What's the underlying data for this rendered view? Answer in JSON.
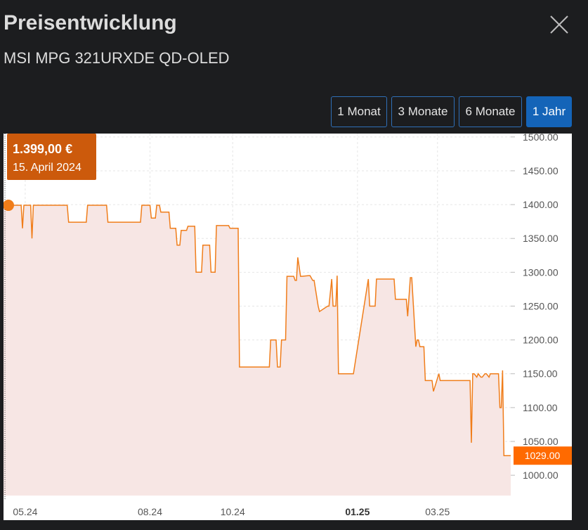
{
  "header": {
    "title": "Preisentwicklung",
    "subtitle": "MSI MPG 321URXDE QD-OLED",
    "close_icon": "close-icon"
  },
  "range_buttons": [
    {
      "label": "1 Monat",
      "active": false
    },
    {
      "label": "3 Monate",
      "active": false
    },
    {
      "label": "6 Monate",
      "active": false
    },
    {
      "label": "1 Jahr",
      "active": true
    }
  ],
  "tooltip": {
    "price": "1.399,00 €",
    "date": "15. April 2024"
  },
  "current_price_label": "1029.00",
  "colors": {
    "background": "#1c1d1f",
    "line": "#f07d1a",
    "area": "#f7e6e4",
    "tooltip_bg": "#cc5a0c",
    "current_label_bg": "#ff6a00",
    "active_button": "#1464b8"
  },
  "chart_data": {
    "type": "line",
    "x": [
      "2024-04-15",
      "2024-04-28",
      "2024-04-29",
      "2024-04-30",
      "2024-05-05",
      "2024-05-06",
      "2024-05-07",
      "2024-06-01",
      "2024-06-02",
      "2024-06-15",
      "2024-06-16",
      "2024-06-30",
      "2024-07-01",
      "2024-07-25",
      "2024-07-26",
      "2024-08-01",
      "2024-08-02",
      "2024-08-05",
      "2024-08-06",
      "2024-08-08",
      "2024-08-09",
      "2024-08-15",
      "2024-08-16",
      "2024-08-20",
      "2024-08-21",
      "2024-08-23",
      "2024-08-24",
      "2024-08-28",
      "2024-08-29",
      "2024-09-03",
      "2024-09-04",
      "2024-09-08",
      "2024-09-09",
      "2024-09-14",
      "2024-09-15",
      "2024-09-18",
      "2024-09-19",
      "2024-09-21",
      "2024-09-22",
      "2024-09-28",
      "2024-09-29",
      "2024-10-05",
      "2024-10-06",
      "2024-10-07",
      "2024-10-08",
      "2024-10-28",
      "2024-10-29",
      "2024-11-02",
      "2024-11-03",
      "2024-11-05",
      "2024-11-06",
      "2024-11-09",
      "2024-11-10",
      "2024-11-15",
      "2024-11-16",
      "2024-11-17",
      "2024-11-18",
      "2024-11-20",
      "2024-11-21",
      "2024-11-26",
      "2024-11-27",
      "2024-11-29",
      "2024-11-30",
      "2024-12-03",
      "2024-12-04",
      "2024-12-10",
      "2024-12-11",
      "2024-12-13",
      "2024-12-14",
      "2024-12-16",
      "2024-12-17",
      "2024-12-18",
      "2024-12-19",
      "2024-12-24",
      "2024-12-25",
      "2024-12-28",
      "2024-12-29",
      "2025-01-09",
      "2025-01-10",
      "2025-01-12",
      "2025-01-13",
      "2025-01-14",
      "2025-01-15",
      "2025-01-28",
      "2025-01-29",
      "2025-02-01",
      "2025-02-02",
      "2025-02-06",
      "2025-02-07",
      "2025-02-09",
      "2025-02-10",
      "2025-02-13",
      "2025-02-14",
      "2025-02-15",
      "2025-02-16",
      "2025-02-19",
      "2025-02-20",
      "2025-02-25",
      "2025-02-26",
      "2025-03-02",
      "2025-03-03",
      "2025-03-25",
      "2025-03-26",
      "2025-03-27",
      "2025-03-28",
      "2025-03-30",
      "2025-03-31",
      "2025-04-02",
      "2025-04-03",
      "2025-04-05",
      "2025-04-06",
      "2025-04-08",
      "2025-04-09",
      "2025-04-15",
      "2025-04-16",
      "2025-04-17",
      "2025-04-18",
      "2025-04-19",
      "2025-04-21",
      "2025-04-24"
    ],
    "values": [
      1399,
      1399,
      1365,
      1399,
      1399,
      1350,
      1399,
      1399,
      1374,
      1374,
      1399,
      1399,
      1374,
      1374,
      1399,
      1399,
      1380,
      1380,
      1399,
      1399,
      1389,
      1389,
      1365,
      1365,
      1340,
      1340,
      1362,
      1362,
      1368,
      1368,
      1300,
      1300,
      1340,
      1340,
      1300,
      1300,
      1369,
      1369,
      1369,
      1369,
      1365,
      1365,
      1160,
      1160,
      1160,
      1160,
      1200,
      1200,
      1160,
      1160,
      1200,
      1200,
      1294,
      1294,
      1288,
      1288,
      1322,
      1294,
      1294,
      1295,
      1295,
      1288,
      1288,
      1250,
      1242,
      1250,
      1250,
      1290,
      1250,
      1250,
      1295,
      1150,
      1150,
      1150,
      1150,
      1150,
      1150,
      1290,
      1250,
      1250,
      1250,
      1250,
      1290,
      1290,
      1260,
      1260,
      1260,
      1260,
      1235,
      1292,
      1292,
      1190,
      1200,
      1200,
      1190,
      1190,
      1140,
      1140,
      1124,
      1150,
      1140,
      1140,
      1048,
      1150,
      1150,
      1145,
      1150,
      1145,
      1145,
      1150,
      1150,
      1145,
      1150,
      1150,
      1100,
      1100,
      1155,
      1029,
      1029,
      1029
    ],
    "x_tick_labels": [
      {
        "date": "2024-05-01",
        "label": "05.24",
        "bold": false
      },
      {
        "date": "2024-08-01",
        "label": "08.24",
        "bold": false
      },
      {
        "date": "2024-10-01",
        "label": "10.24",
        "bold": false
      },
      {
        "date": "2025-01-01",
        "label": "01.25",
        "bold": true
      },
      {
        "date": "2025-03-01",
        "label": "03.25",
        "bold": false
      }
    ],
    "y_ticks": [
      1000,
      1050,
      1100,
      1150,
      1200,
      1250,
      1300,
      1350,
      1400,
      1450,
      1500
    ],
    "y_tick_labels": [
      "1000.00",
      "1050.00",
      "1100.00",
      "1150.00",
      "1200.00",
      "1250.00",
      "1300.00",
      "1350.00",
      "1400.00",
      "1450.00",
      "1500.00"
    ],
    "ylim": [
      970,
      1505
    ],
    "xlim": [
      "2024-04-15",
      "2025-04-24"
    ],
    "grid": true,
    "y_axis_position": "right"
  }
}
